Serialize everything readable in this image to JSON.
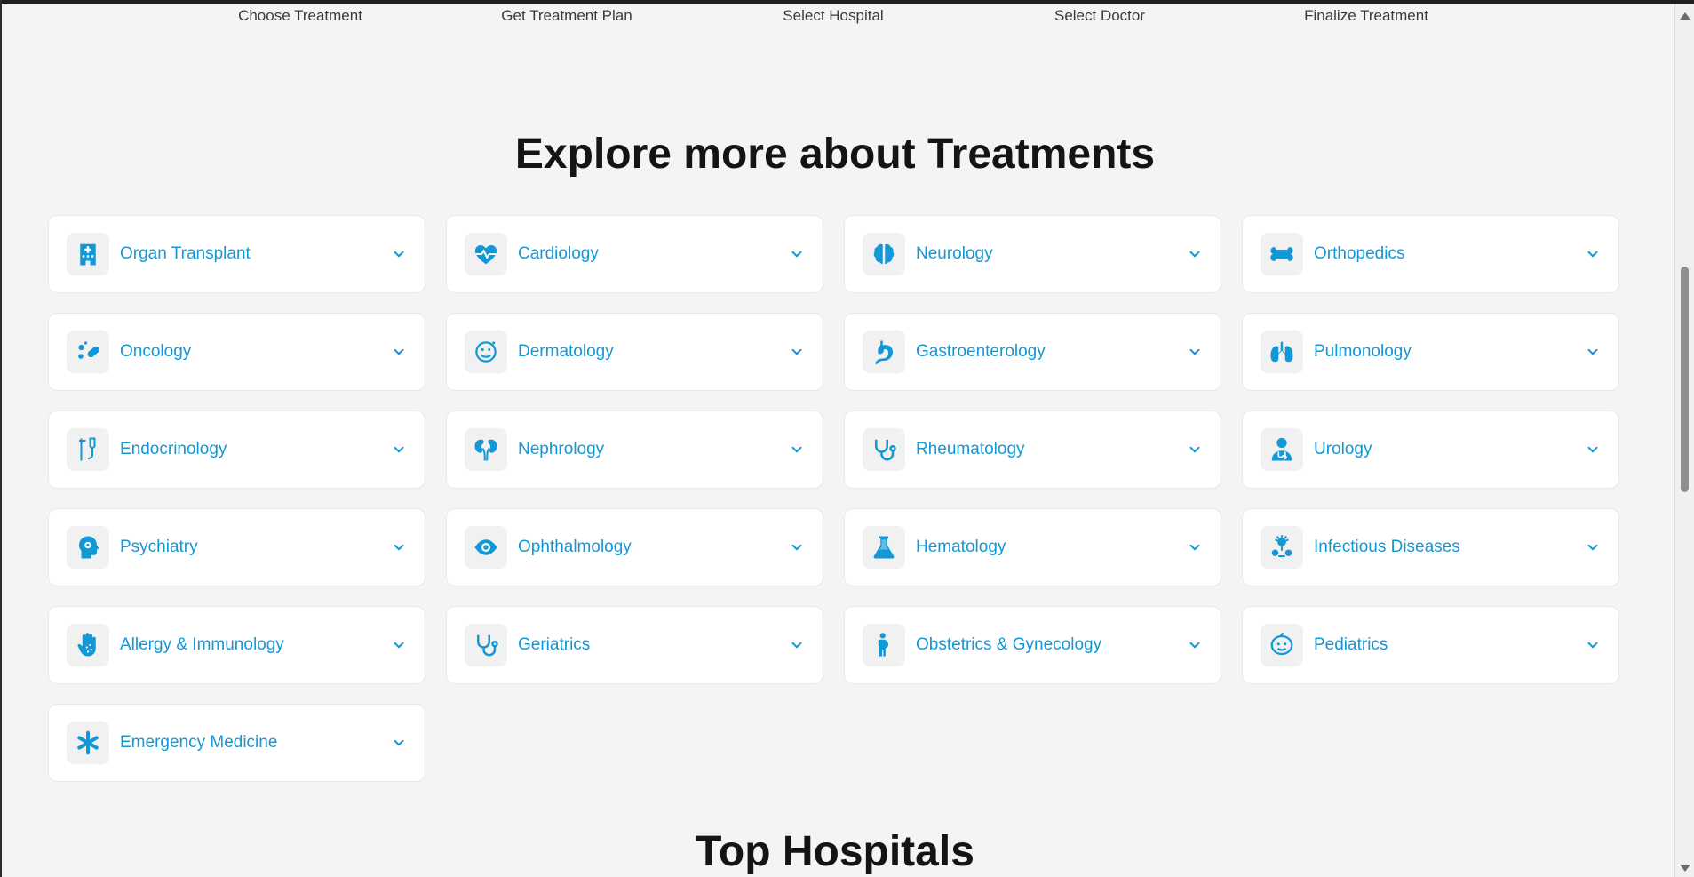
{
  "steps": [
    "Choose Treatment",
    "Get Treatment Plan",
    "Select Hospital",
    "Select Doctor",
    "Finalize Treatment"
  ],
  "explore_title": "Explore more about Treatments",
  "hospitals_title": "Top Hospitals",
  "accent_color": "#1298d6",
  "treatments": [
    {
      "label": "Organ Transplant",
      "icon": "hospital-building-icon"
    },
    {
      "label": "Cardiology",
      "icon": "heart-pulse-icon"
    },
    {
      "label": "Neurology",
      "icon": "brain-icon"
    },
    {
      "label": "Orthopedics",
      "icon": "bone-icon"
    },
    {
      "label": "Oncology",
      "icon": "pills-icon"
    },
    {
      "label": "Dermatology",
      "icon": "face-skin-icon"
    },
    {
      "label": "Gastroenterology",
      "icon": "stomach-icon"
    },
    {
      "label": "Pulmonology",
      "icon": "lungs-icon"
    },
    {
      "label": "Endocrinology",
      "icon": "iv-drip-icon"
    },
    {
      "label": "Nephrology",
      "icon": "kidneys-icon"
    },
    {
      "label": "Rheumatology",
      "icon": "stethoscope-icon"
    },
    {
      "label": "Urology",
      "icon": "doctor-icon"
    },
    {
      "label": "Psychiatry",
      "icon": "head-gear-icon"
    },
    {
      "label": "Ophthalmology",
      "icon": "eye-icon"
    },
    {
      "label": "Hematology",
      "icon": "flask-icon"
    },
    {
      "label": "Infectious Diseases",
      "icon": "virus-icon"
    },
    {
      "label": "Allergy & Immunology",
      "icon": "hand-dots-icon"
    },
    {
      "label": "Geriatrics",
      "icon": "stethoscope-icon"
    },
    {
      "label": "Obstetrics & Gynecology",
      "icon": "person-pregnant-icon"
    },
    {
      "label": "Pediatrics",
      "icon": "child-face-icon"
    },
    {
      "label": "Emergency Medicine",
      "icon": "asterisk-icon"
    }
  ]
}
